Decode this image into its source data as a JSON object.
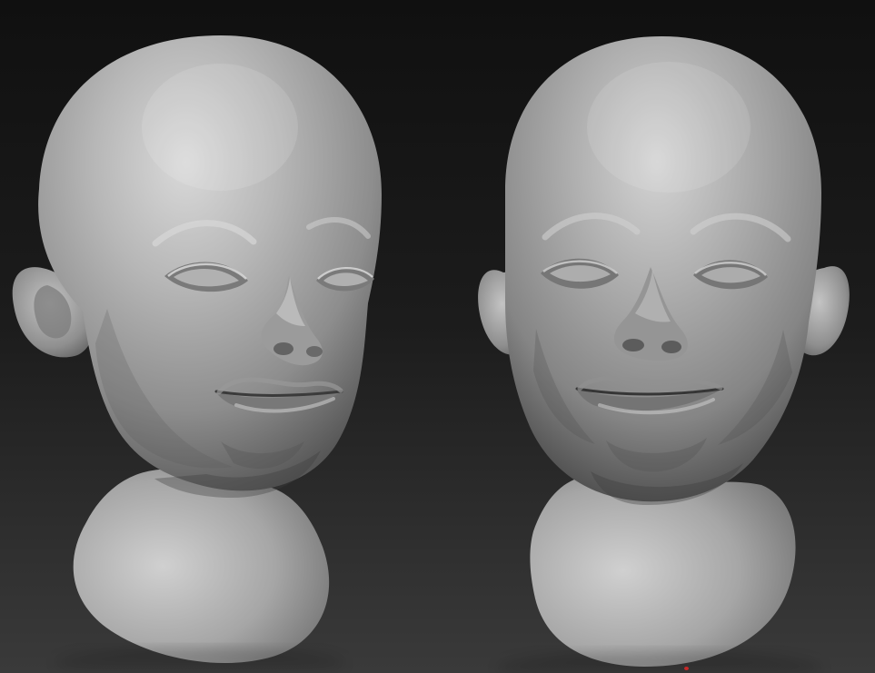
{
  "scene": {
    "subject_count": 2,
    "background_top": "#101010",
    "background_bottom": "#3a3a3a",
    "clay_light": "#d7d7d7",
    "clay_mid": "#9a9a9a",
    "clay_dark": "#3f3f3f",
    "marker_color": "#c62828"
  }
}
